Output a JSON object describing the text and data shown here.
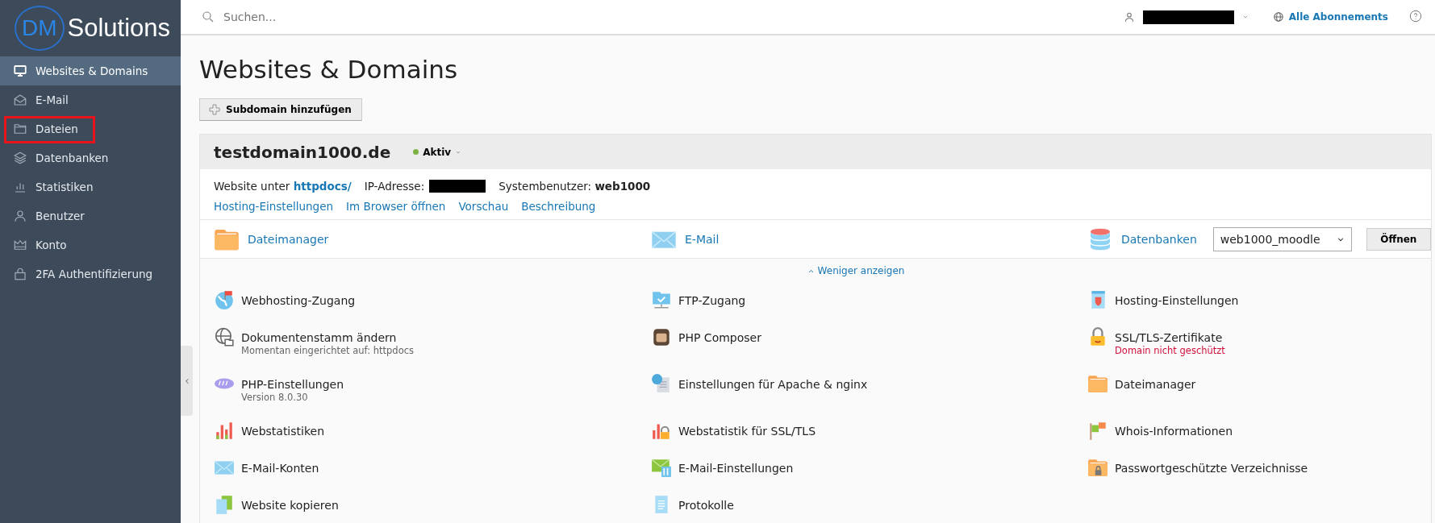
{
  "logo": {
    "mark_text": "DM",
    "name_text": "Solutions"
  },
  "sidebar": {
    "items": [
      {
        "label": "Websites & Domains",
        "selected": true,
        "highlighted": false
      },
      {
        "label": "E-Mail",
        "selected": false,
        "highlighted": false
      },
      {
        "label": "Dateien",
        "selected": false,
        "highlighted": true
      },
      {
        "label": "Datenbanken",
        "selected": false,
        "highlighted": false
      },
      {
        "label": "Statistiken",
        "selected": false,
        "highlighted": false
      },
      {
        "label": "Benutzer",
        "selected": false,
        "highlighted": false
      },
      {
        "label": "Konto",
        "selected": false,
        "highlighted": false
      },
      {
        "label": "2FA Authentifizierung",
        "selected": false,
        "highlighted": false
      }
    ]
  },
  "header": {
    "search": {
      "placeholder": "Suchen..."
    },
    "subscriptions_link": "Alle Abonnements"
  },
  "page": {
    "title": "Websites & Domains",
    "add_button": "Subdomain hinzufügen"
  },
  "domain": {
    "name": "testdomain1000.de",
    "status": "Aktiv",
    "website_label": "Website unter",
    "docroot_link": "httpdocs/",
    "ip_label": "IP-Adresse:",
    "sysuser_label": "Systembenutzer:",
    "sysuser": "web1000",
    "links": [
      "Hosting-Einstellungen",
      "Im Browser öffnen",
      "Vorschau",
      "Beschreibung"
    ],
    "quick": [
      "Dateimanager",
      "E-Mail",
      "Datenbanken"
    ],
    "db_select": "web1000_moodle",
    "open_button": "Öffnen",
    "toggle": "Weniger anzeigen",
    "tools": [
      {
        "label": "Webhosting-Zugang"
      },
      {
        "label": "FTP-Zugang"
      },
      {
        "label": "Hosting-Einstellungen"
      },
      {
        "label": "Dokumentenstamm ändern",
        "note": {
          "text": "Momentan eingerichtet auf: httpdocs",
          "alert": false
        }
      },
      {
        "label": "PHP Composer"
      },
      {
        "label": "SSL/TLS-Zertifikate",
        "note": {
          "text": "Domain nicht geschützt",
          "alert": true
        }
      },
      {
        "label": "PHP-Einstellungen",
        "note": {
          "text": "Version 8.0.30",
          "alert": false
        }
      },
      {
        "label": "Einstellungen für Apache & nginx"
      },
      {
        "label": "Dateimanager"
      },
      {
        "label": "Webstatistiken"
      },
      {
        "label": "Webstatistik für SSL/TLS"
      },
      {
        "label": "Whois-Informationen"
      },
      {
        "label": "E-Mail-Konten"
      },
      {
        "label": "E-Mail-Einstellungen"
      },
      {
        "label": "Passwortgeschützte Verzeichnisse"
      },
      {
        "label": "Website kopieren"
      },
      {
        "label": "Protokolle"
      }
    ]
  }
}
